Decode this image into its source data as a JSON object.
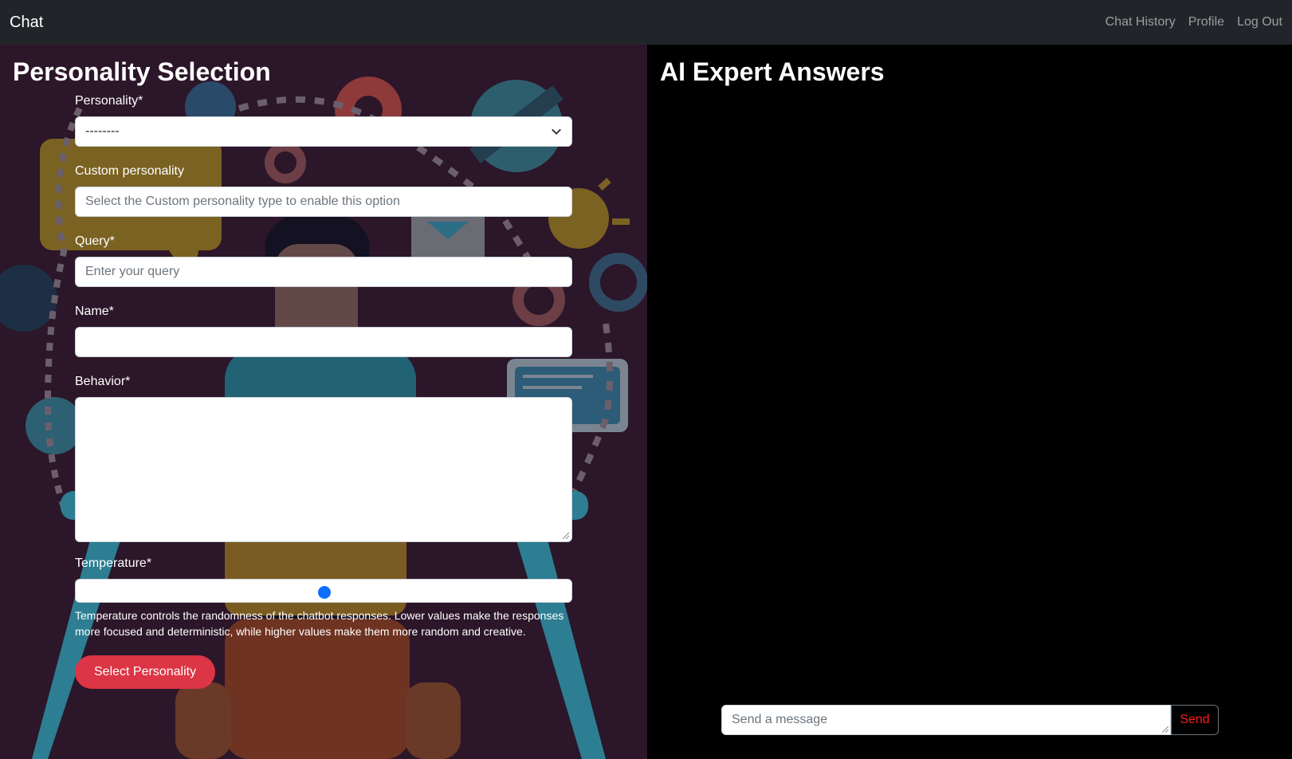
{
  "nav": {
    "brand": "Chat",
    "links": [
      "Chat History",
      "Profile",
      "Log Out"
    ]
  },
  "left": {
    "title": "Personality Selection",
    "form": {
      "personality_label": "Personality*",
      "personality_value": "--------",
      "custom_label": "Custom personality",
      "custom_placeholder": "Select the Custom personality type to enable this option",
      "query_label": "Query*",
      "query_placeholder": "Enter your query",
      "name_label": "Name*",
      "name_value": "",
      "behavior_label": "Behavior*",
      "behavior_value": "",
      "temperature_label": "Temperature*",
      "temperature_level": 0.5,
      "temperature_help": "Temperature controls the randomness of the chatbot responses. Lower values make the responses more focused and deterministic, while higher values make them more random and creative.",
      "submit_label": "Select Personality"
    }
  },
  "right": {
    "title": "AI Expert Answers",
    "message_placeholder": "Send a message",
    "send_label": "Send"
  },
  "colors": {
    "navbar": "#212529",
    "primary_button": "#dc3545",
    "slider_thumb": "#0d6efd",
    "send_text": "#ff1a1a"
  }
}
